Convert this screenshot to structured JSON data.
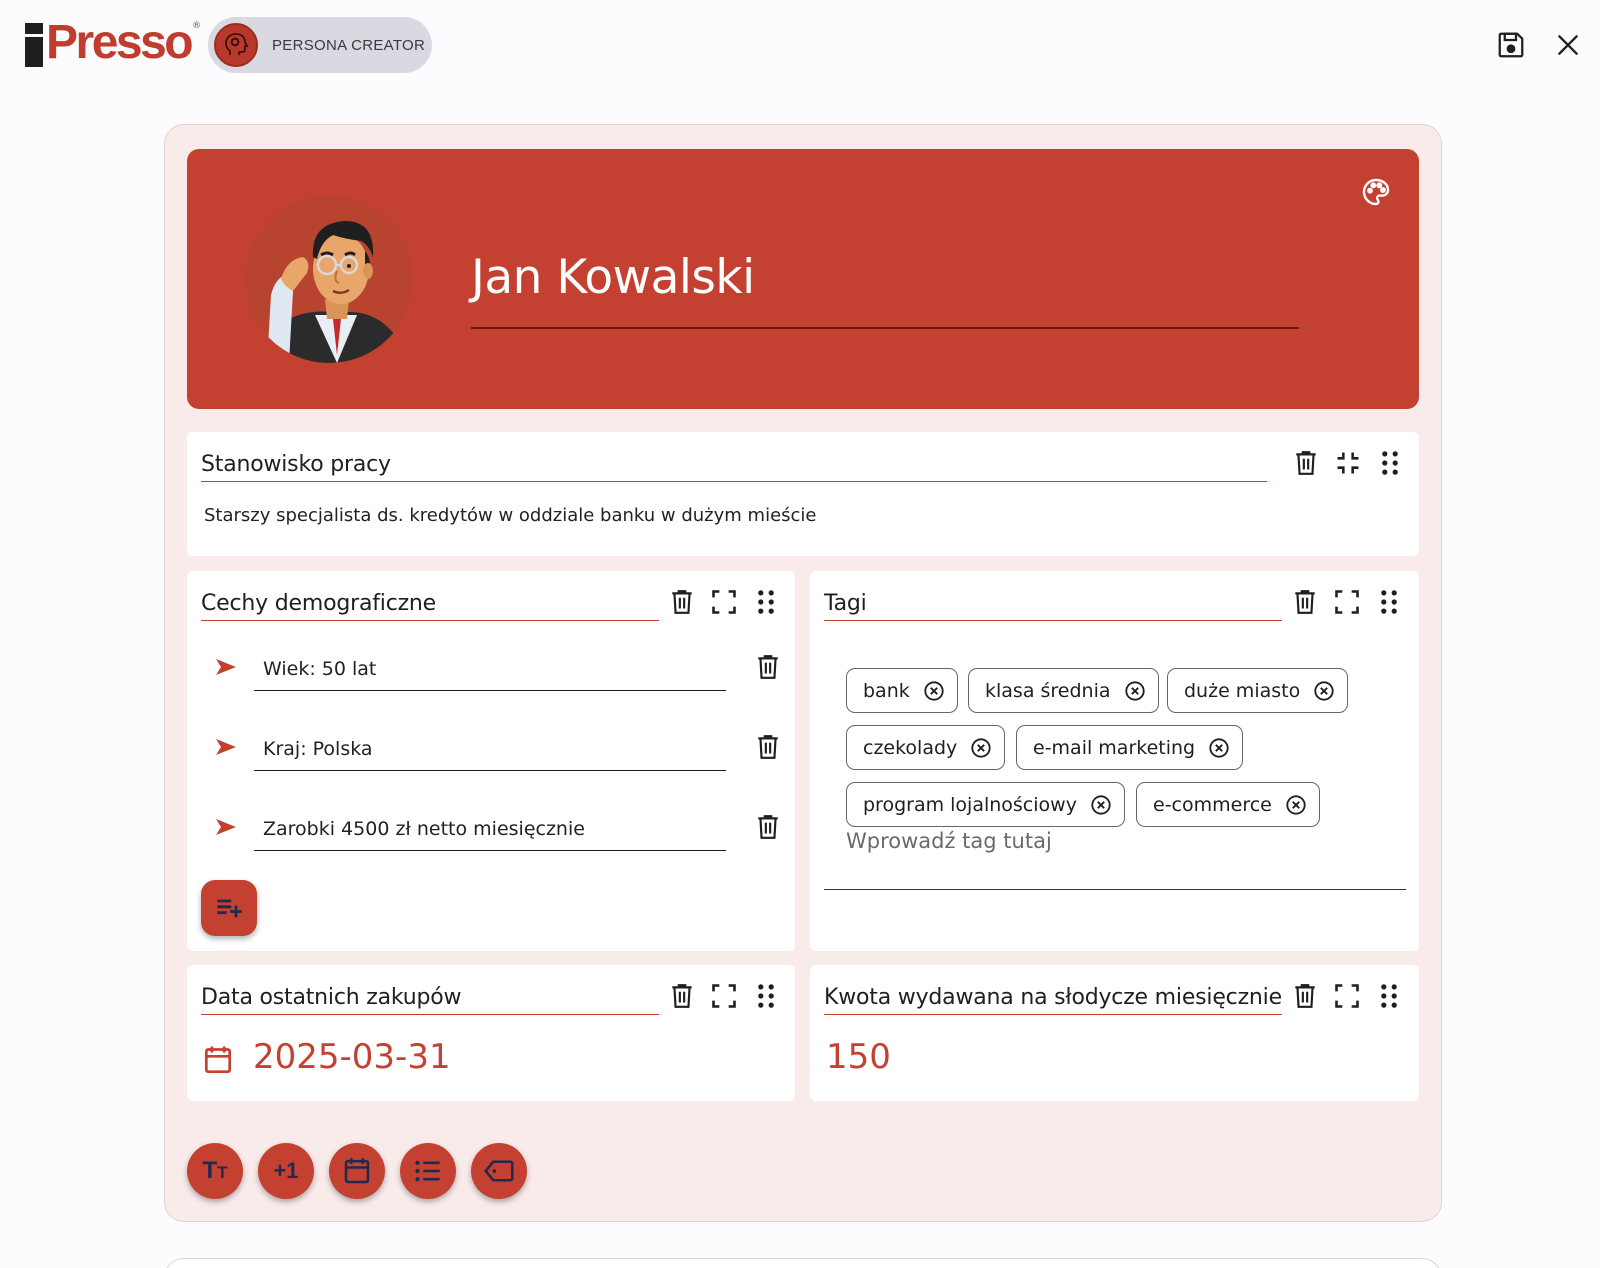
{
  "app": {
    "brand": "iPresso",
    "module_label": "PERSONA CREATOR",
    "accent_color": "#c44131",
    "icons": {
      "save": "save-icon",
      "close": "close-icon",
      "palette": "palette-icon",
      "delete": "trash-icon",
      "fullscreen": "fullscreen-icon",
      "drag": "drag-handle-icon",
      "bullet": "arrow-bullet-icon",
      "calendar": "calendar-icon",
      "tag_remove": "circle-x-icon"
    }
  },
  "persona": {
    "name": "Jan Kowalski"
  },
  "sections": {
    "job": {
      "title": "Stanowisko pracy",
      "text": "Starszy specjalista ds. kredytów w oddziale banku w dużym mieście"
    },
    "demographics": {
      "title": "Cechy demograficzne",
      "items": [
        "Wiek: 50 lat",
        "Kraj: Polska",
        "Zarobki 4500 zł netto miesięcznie"
      ]
    },
    "tags": {
      "title": "Tagi",
      "items": [
        "bank",
        "klasa średnia",
        "duże miasto",
        "czekolady",
        "e-mail marketing",
        "program lojalnościowy",
        "e-commerce"
      ],
      "input_placeholder": "Wprowadź tag tutaj"
    },
    "last_purchase": {
      "title": "Data ostatnich zakupów",
      "value": "2025-03-31"
    },
    "sweets_amount": {
      "title": "Kwota wydawana na słodycze miesięcznie",
      "value": "150"
    }
  },
  "toolbar": {
    "add_text_label": "TT",
    "add_number_label": "+1",
    "buttons": [
      "add-text",
      "add-number",
      "add-date",
      "add-list",
      "add-tags"
    ]
  }
}
